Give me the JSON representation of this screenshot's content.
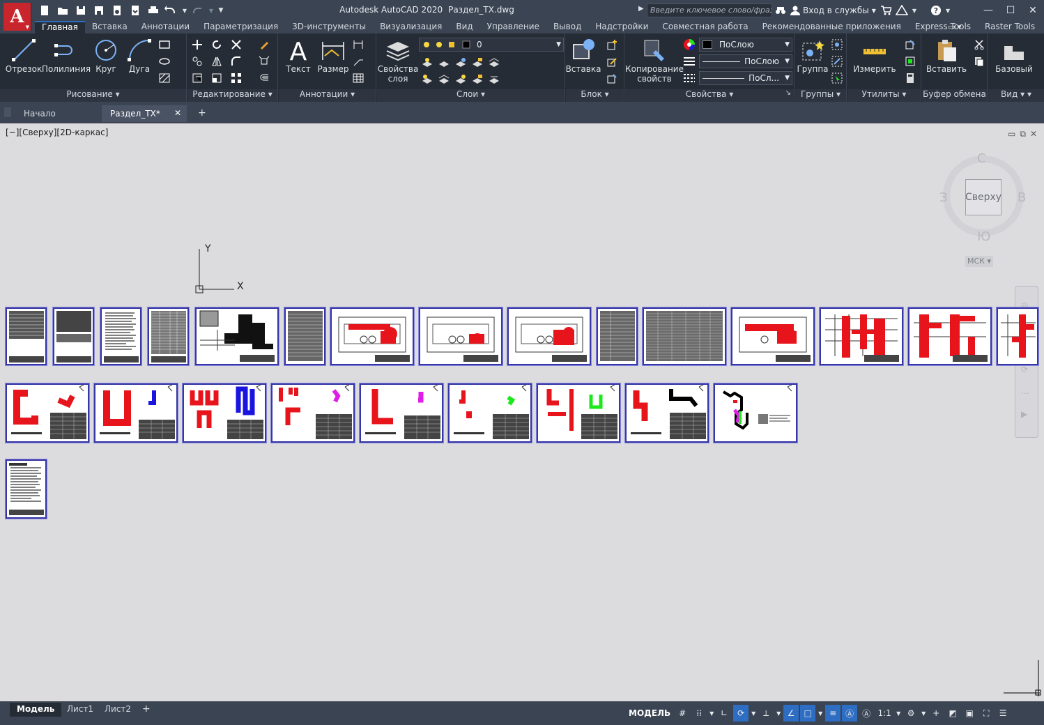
{
  "app": {
    "logo_letter": "A",
    "title": "Autodesk AutoCAD 2020",
    "filename": "Раздел_ТХ.dwg",
    "search_placeholder": "Введите ключевое слово/фразу",
    "signin_label": "Вход в службы"
  },
  "ribbon_tabs": [
    "Главная",
    "Вставка",
    "Аннотации",
    "Параметризация",
    "3D-инструменты",
    "Визуализация",
    "Вид",
    "Управление",
    "Вывод",
    "Надстройки",
    "Совместная работа",
    "Рекомендованные приложения",
    "Express Tools",
    "Raster Tools"
  ],
  "ribbon": {
    "draw": {
      "title": "Рисование",
      "line": "Отрезок",
      "polyline": "Полилиния",
      "circle": "Круг",
      "arc": "Дуга"
    },
    "modify": {
      "title": "Редактирование"
    },
    "annotation": {
      "title": "Аннотации",
      "text": "Текст",
      "dimension": "Размер"
    },
    "layers": {
      "title": "Слои",
      "layer_props_1": "Свойства",
      "layer_props_2": "слоя",
      "current_layer": "0"
    },
    "block": {
      "title": "Блок",
      "insert": "Вставка"
    },
    "properties": {
      "title": "Свойства",
      "match_1": "Копирование",
      "match_2": "свойств",
      "color": "ПоСлою",
      "linetype": "ПоСлою",
      "lineweight": "ПоСл..."
    },
    "groups": {
      "title": "Группы",
      "group": "Группа"
    },
    "utilities": {
      "title": "Утилиты",
      "measure": "Измерить"
    },
    "clipboard": {
      "title": "Буфер обмена",
      "paste": "Вставить"
    },
    "view": {
      "title": "Вид",
      "base": "Базовый"
    }
  },
  "doc_tabs": {
    "start": "Начало",
    "active": "Раздел_ТХ*"
  },
  "viewport": {
    "label": "[−][Сверху][2D-каркас]",
    "viewcube": {
      "top": "Сверху",
      "north": "С",
      "south": "Ю",
      "west": "З",
      "east": "В",
      "ucs": "МСК"
    },
    "ucs_axes": {
      "x": "X",
      "y": "Y"
    }
  },
  "layout_tabs": [
    "Модель",
    "Лист1",
    "Лист2"
  ],
  "status": {
    "model": "МОДЕЛЬ",
    "scale": "1:1"
  },
  "colors": {
    "accent": "#2d6dc2",
    "sheet_border": "#3636a6",
    "red": "#e8141c",
    "blue": "#1a14e0",
    "magenta": "#e01ce8",
    "green": "#1ce81c",
    "canvas": "#dcdbde"
  }
}
